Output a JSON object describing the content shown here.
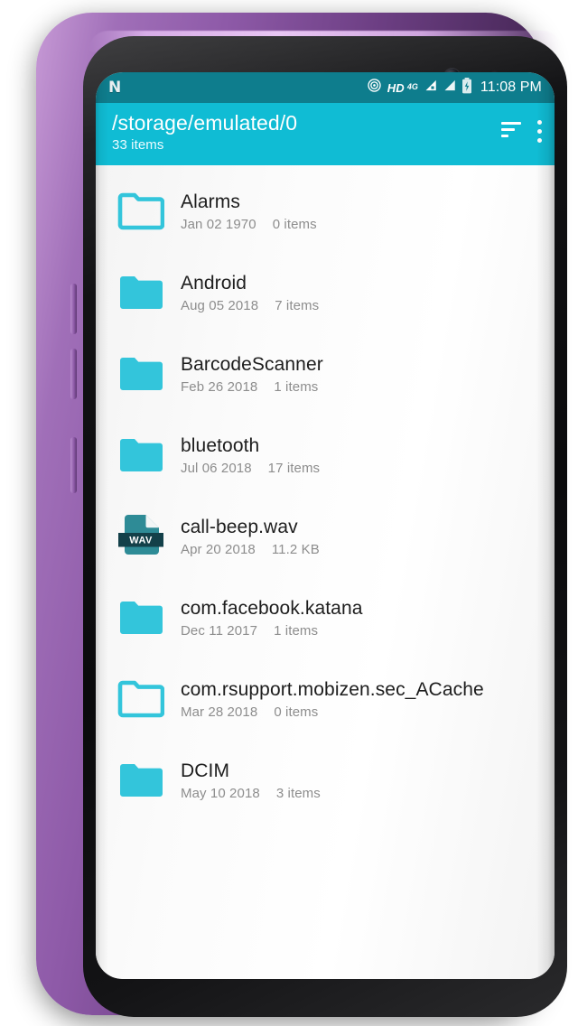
{
  "theme": {
    "status_bar_color": "#0e7d8d",
    "app_bar_color": "#10bcd4",
    "folder_color": "#33c5db",
    "file_icon_color": "#2e8b96",
    "file_icon_label_color": "#134049",
    "list_background": "#fbfbfb",
    "primary_text_color": "#1d1d1d",
    "secondary_text_color": "#8d8d8d",
    "phone_frame_color": "#8e5aa8"
  },
  "status_bar": {
    "os_logo": "android-nougat-n-logo",
    "icons": [
      "hotspot-icon",
      "hd-voice-icon",
      "4g-icon",
      "signal-bars-icon",
      "signal-bars-icon",
      "battery-charging-icon"
    ],
    "hd_label": "HD",
    "network_label": "4G",
    "clock": "11:08 PM"
  },
  "app_bar": {
    "title": "/storage/emulated/0",
    "subtitle": "33 items",
    "actions": [
      {
        "name": "sort-button",
        "icon": "sort-icon"
      },
      {
        "name": "overflow-menu-button",
        "icon": "more-vertical-icon"
      }
    ]
  },
  "files": [
    {
      "name": "Alarms",
      "date": "Jan 02 1970",
      "size": "0 items",
      "type": "folder",
      "icon": "folder-outline-icon"
    },
    {
      "name": "Android",
      "date": "Aug 05 2018",
      "size": "7 items",
      "type": "folder",
      "icon": "folder-filled-icon"
    },
    {
      "name": "BarcodeScanner",
      "date": "Feb 26 2018",
      "size": "1 items",
      "type": "folder",
      "icon": "folder-filled-icon"
    },
    {
      "name": "bluetooth",
      "date": "Jul 06 2018",
      "size": "17 items",
      "type": "folder",
      "icon": "folder-filled-icon"
    },
    {
      "name": "call-beep.wav",
      "date": "Apr 20 2018",
      "size": "11.2 KB",
      "type": "file",
      "icon": "wav-file-icon",
      "extension_label": "WAV"
    },
    {
      "name": "com.facebook.katana",
      "date": "Dec 11 2017",
      "size": "1 items",
      "type": "folder",
      "icon": "folder-filled-icon"
    },
    {
      "name": "com.rsupport.mobizen.sec_ACache",
      "date": "Mar 28 2018",
      "size": "0 items",
      "type": "folder",
      "icon": "folder-outline-icon"
    },
    {
      "name": "DCIM",
      "date": "May 10 2018",
      "size": "3 items",
      "type": "folder",
      "icon": "folder-filled-icon"
    }
  ]
}
